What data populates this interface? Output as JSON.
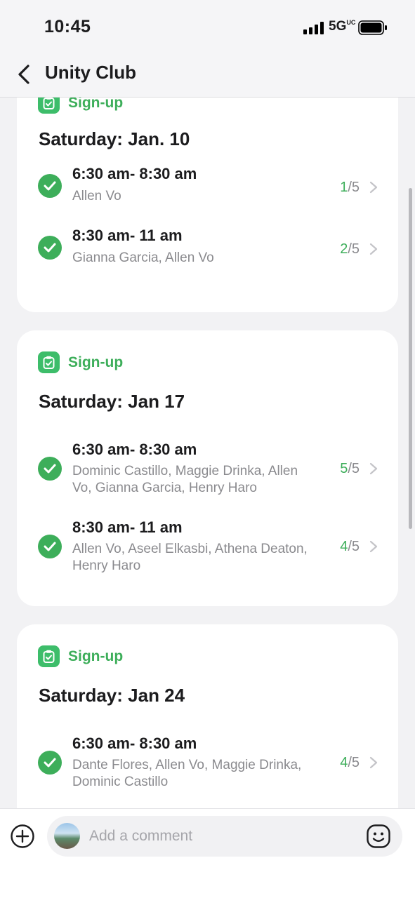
{
  "status_bar": {
    "time": "10:45",
    "network": "5G",
    "network_suffix": "UC"
  },
  "header": {
    "title": "Unity Club"
  },
  "cards": [
    {
      "badge": "Sign-up",
      "date": "Saturday: Jan. 10",
      "slots": [
        {
          "time": "6:30 am- 8:30 am",
          "names": "Allen Vo",
          "filled": "1",
          "total": "/5"
        },
        {
          "time": "8:30 am- 11 am",
          "names": "Gianna Garcia, Allen Vo",
          "filled": "2",
          "total": "/5"
        }
      ]
    },
    {
      "badge": "Sign-up",
      "date": "Saturday: Jan 17",
      "slots": [
        {
          "time": "6:30 am- 8:30 am",
          "names": "Dominic Castillo, Maggie Drinka, Allen Vo, Gianna Garcia, Henry Haro",
          "filled": "5",
          "total": "/5"
        },
        {
          "time": "8:30 am- 11 am",
          "names": "Allen Vo, Aseel Elkasbi, Athena Deaton, Henry Haro",
          "filled": "4",
          "total": "/5"
        }
      ]
    },
    {
      "badge": "Sign-up",
      "date": "Saturday: Jan 24",
      "slots": [
        {
          "time": "6:30 am- 8:30 am",
          "names": "Dante Flores, Allen Vo, Maggie Drinka, Dominic Castillo",
          "filled": "4",
          "total": "/5"
        }
      ]
    }
  ],
  "comment": {
    "placeholder": "Add a comment"
  },
  "colors": {
    "accent": "#3dae5a",
    "badge_bg": "#3dbd6a",
    "muted": "#8a8a8e"
  }
}
